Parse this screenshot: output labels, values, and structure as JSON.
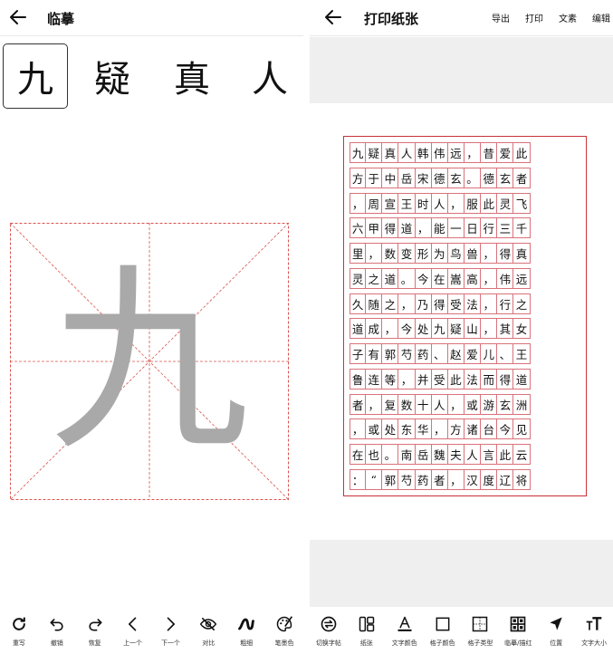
{
  "left": {
    "title": "临摹",
    "chars": [
      "九",
      "疑",
      "真",
      "人"
    ],
    "active_index": 0,
    "guide_char": "九",
    "toolbar": [
      {
        "label": "重写",
        "icon": "rewrite-icon"
      },
      {
        "label": "撤销",
        "icon": "undo-icon"
      },
      {
        "label": "恢复",
        "icon": "redo-icon"
      },
      {
        "label": "上一个",
        "icon": "chevron-left-icon"
      },
      {
        "label": "下一个",
        "icon": "chevron-right-icon"
      },
      {
        "label": "对比",
        "icon": "eye-off-icon"
      },
      {
        "label": "粗细",
        "icon": "stroke-width-icon"
      },
      {
        "label": "笔墨色",
        "icon": "palette-icon"
      }
    ]
  },
  "right": {
    "title": "打印纸张",
    "actions": [
      "导出",
      "打印",
      "文素",
      "编辑"
    ],
    "grid_rows": [
      [
        "九",
        "疑",
        "真",
        "人",
        "韩",
        "伟",
        "远",
        "，",
        "昔",
        "爱",
        "此"
      ],
      [
        "方",
        "于",
        "中",
        "岳",
        "宋",
        "德",
        "玄",
        "。",
        "德",
        "玄",
        "者"
      ],
      [
        "，",
        "周",
        "宣",
        "王",
        "时",
        "人",
        "，",
        "服",
        "此",
        "灵",
        "飞"
      ],
      [
        "六",
        "甲",
        "得",
        "道",
        "，",
        "能",
        "一",
        "日",
        "行",
        "三",
        "千"
      ],
      [
        "里",
        "，",
        "数",
        "变",
        "形",
        "为",
        "鸟",
        "兽",
        "，",
        "得",
        "真"
      ],
      [
        "灵",
        "之",
        "道",
        "。",
        "今",
        "在",
        "嵩",
        "高",
        "，",
        "伟",
        "远"
      ],
      [
        "久",
        "随",
        "之",
        "，",
        "乃",
        "得",
        "受",
        "法",
        "，",
        "行",
        "之"
      ],
      [
        "道",
        "成",
        "，",
        "今",
        "处",
        "九",
        "疑",
        "山",
        "，",
        "其",
        "女"
      ],
      [
        "子",
        "有",
        "郭",
        "芍",
        "药",
        "、",
        "赵",
        "爱",
        "儿",
        "、",
        "王"
      ],
      [
        "鲁",
        "连",
        "等",
        "，",
        "并",
        "受",
        "此",
        "法",
        "而",
        "得",
        "道"
      ],
      [
        "者",
        "，",
        "复",
        "数",
        "十",
        "人",
        "，",
        "或",
        "游",
        "玄",
        "洲"
      ],
      [
        "，",
        "或",
        "处",
        "东",
        "华",
        "，",
        "方",
        "诸",
        "台",
        "今",
        "见"
      ],
      [
        "在",
        "也",
        "。",
        "南",
        "岳",
        "魏",
        "夫",
        "人",
        "言",
        "此",
        "云"
      ],
      [
        "：",
        "“",
        "郭",
        "芍",
        "药",
        "者",
        "，",
        "汉",
        "度",
        "辽",
        "将"
      ]
    ],
    "toolbar": [
      {
        "label": "切换字帖",
        "icon": "switch-copybook-icon"
      },
      {
        "label": "纸张",
        "icon": "paper-icon"
      },
      {
        "label": "文字颜色",
        "icon": "text-color-icon"
      },
      {
        "label": "格子颜色",
        "icon": "grid-color-icon"
      },
      {
        "label": "格子类型",
        "icon": "grid-type-icon"
      },
      {
        "label": "临摹/描红",
        "icon": "trace-mode-icon"
      },
      {
        "label": "位置",
        "icon": "position-icon"
      },
      {
        "label": "文字大小",
        "icon": "text-size-icon"
      }
    ]
  },
  "colors": {
    "grid_border": "#d9727a",
    "paper_border": "#c8323a",
    "guide_char": "#a9a9a9",
    "practice_lines": "#d9534f"
  }
}
